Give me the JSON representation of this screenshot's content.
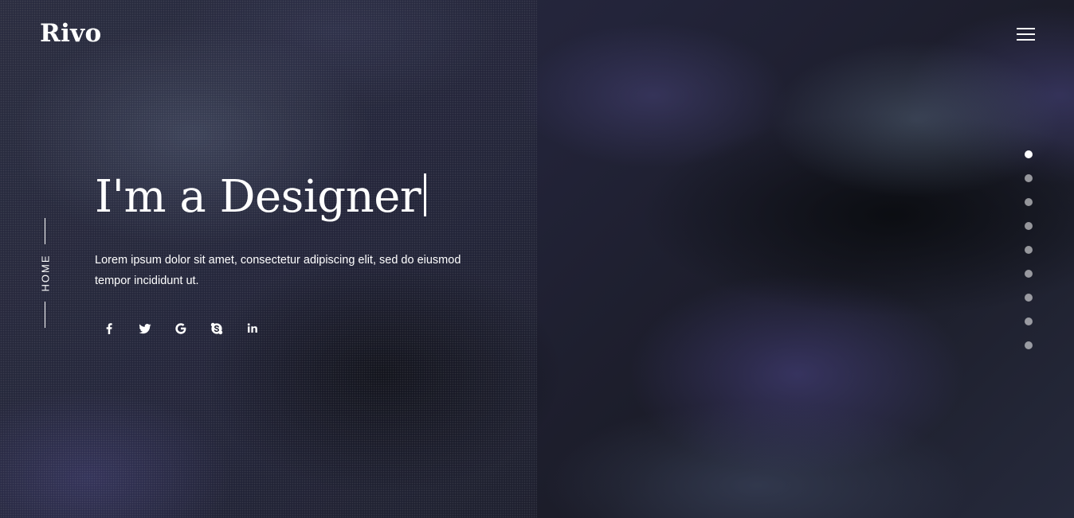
{
  "brand": {
    "logo": "Rivo"
  },
  "header": {
    "menu_icon": "hamburger-menu-icon"
  },
  "side_label": "HOME",
  "hero": {
    "headline": "I'm a Designer",
    "description": "Lorem ipsum dolor sit amet, consectetur adipiscing elit, sed do eiusmod tempor incididunt ut."
  },
  "social": [
    {
      "name": "facebook-icon"
    },
    {
      "name": "twitter-icon"
    },
    {
      "name": "google-icon"
    },
    {
      "name": "skype-icon"
    },
    {
      "name": "linkedin-icon"
    }
  ],
  "pagination": {
    "count": 9,
    "active_index": 0
  }
}
